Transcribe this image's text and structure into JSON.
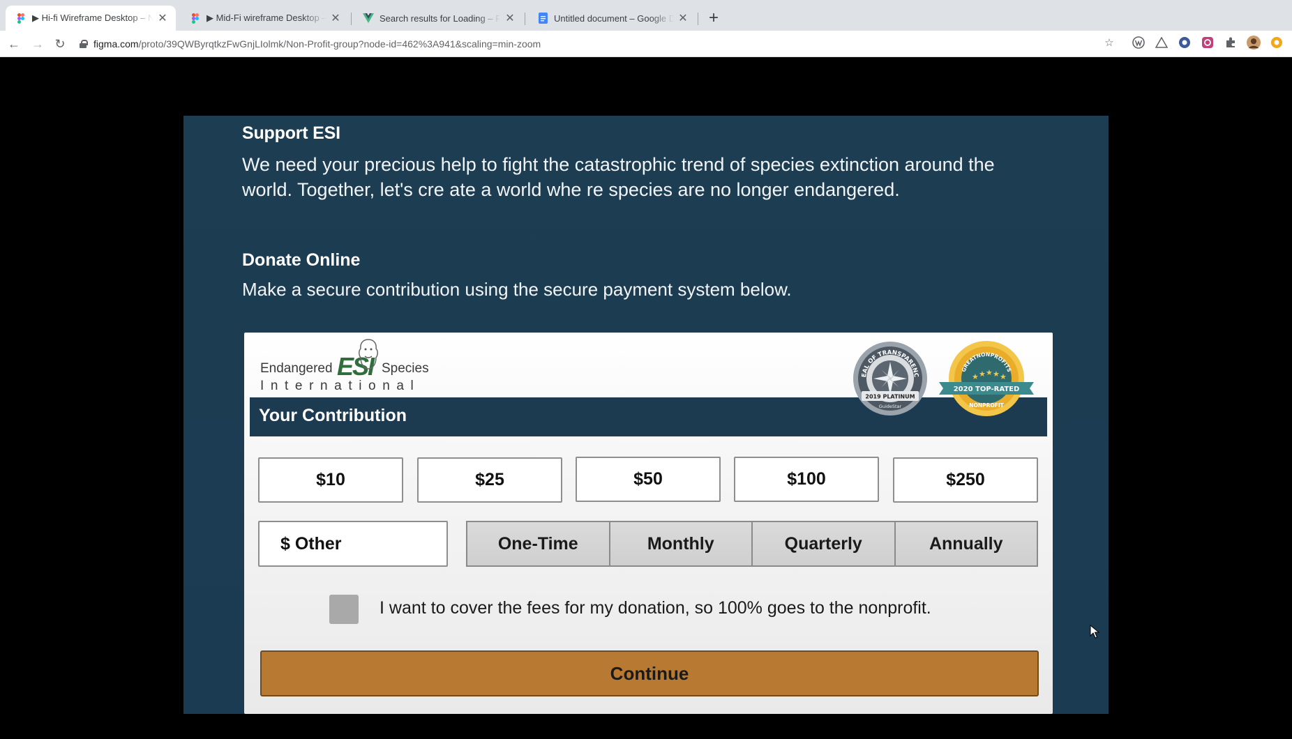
{
  "browser": {
    "tabs": [
      {
        "title": "▶ Hi-fi Wireframe Desktop – N",
        "active": true,
        "icon": "figma-icon"
      },
      {
        "title": "▶ Mid-Fi wireframe Desktop –",
        "active": false,
        "icon": "figma-icon"
      },
      {
        "title": "Search results for Loading – Fi",
        "active": false,
        "icon": "vue-icon"
      },
      {
        "title": "Untitled document – Google D",
        "active": false,
        "icon": "docs-icon"
      }
    ],
    "new_tab_label": "+",
    "url_host": "figma.com",
    "url_path": "/proto/39QWByrqtkzFwGnjLIolmk/Non-Profit-group?node-id=462%3A941&scaling=min-zoom"
  },
  "page": {
    "support_heading": "Support ESI",
    "support_text": "We need your precious help to fight the catastrophic trend of species extinction around the world. Together, let's cre ate a world whe re species are no longer endangered.",
    "donate_heading": "Donate Online",
    "donate_text": "Make a secure contribution using the secure payment system below."
  },
  "form": {
    "logo": {
      "word_left": "Endangered",
      "mark": "ESI",
      "word_right": "Species",
      "word_bottom": "International"
    },
    "section_title": "Your Contribution",
    "seal_transparency": {
      "top": "SEAL OF TRANSPARENCY",
      "ribbon": "2019 PLATINUM",
      "bottom": "GuideStar"
    },
    "seal_top_rated": {
      "top": "GREATNONPROFITS",
      "ribbon": "2020 TOP-RATED",
      "bottom": "NONPROFIT"
    },
    "amounts": [
      "$10",
      "$25",
      "$50",
      "$100",
      "$250"
    ],
    "other_label": "$ Other",
    "frequencies": [
      "One-Time",
      "Monthly",
      "Quarterly",
      "Annually"
    ],
    "cover_fees_label": "I want to cover the fees for my donation, so 100% goes to the nonprofit.",
    "cover_fees_checked": false,
    "continue_label": "Continue"
  },
  "colors": {
    "page_bg": "#1b3c52",
    "continue_bg": "#b87a32",
    "bar_bg": "#1c3a50"
  }
}
